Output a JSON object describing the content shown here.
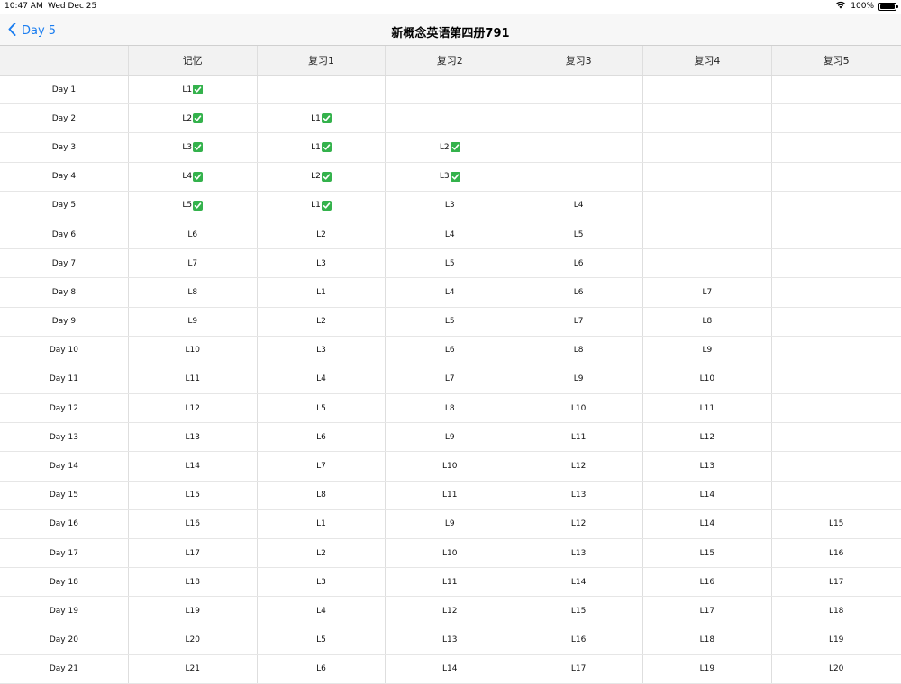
{
  "status_bar": {
    "time": "10:47 AM",
    "date": "Wed Dec 25",
    "battery": "100%",
    "battery_level": 1.0
  },
  "nav": {
    "back_label": "Day 5",
    "title": "新概念英语第四册791"
  },
  "table": {
    "columns": [
      "",
      "记忆",
      "复习1",
      "复习2",
      "复习3",
      "复习4",
      "复习5"
    ],
    "rows": [
      {
        "day": "Day 1",
        "cells": [
          {
            "t": "L1",
            "c": true
          },
          {
            "t": "",
            "c": false
          },
          {
            "t": "",
            "c": false
          },
          {
            "t": "",
            "c": false
          },
          {
            "t": "",
            "c": false
          },
          {
            "t": "",
            "c": false
          }
        ]
      },
      {
        "day": "Day 2",
        "cells": [
          {
            "t": "L2",
            "c": true
          },
          {
            "t": "L1",
            "c": true
          },
          {
            "t": "",
            "c": false
          },
          {
            "t": "",
            "c": false
          },
          {
            "t": "",
            "c": false
          },
          {
            "t": "",
            "c": false
          }
        ]
      },
      {
        "day": "Day 3",
        "cells": [
          {
            "t": "L3",
            "c": true
          },
          {
            "t": "L1",
            "c": true
          },
          {
            "t": "L2",
            "c": true
          },
          {
            "t": "",
            "c": false
          },
          {
            "t": "",
            "c": false
          },
          {
            "t": "",
            "c": false
          }
        ]
      },
      {
        "day": "Day 4",
        "cells": [
          {
            "t": "L4",
            "c": true
          },
          {
            "t": "L2",
            "c": true
          },
          {
            "t": "L3",
            "c": true
          },
          {
            "t": "",
            "c": false
          },
          {
            "t": "",
            "c": false
          },
          {
            "t": "",
            "c": false
          }
        ]
      },
      {
        "day": "Day 5",
        "cells": [
          {
            "t": "L5",
            "c": true
          },
          {
            "t": "L1",
            "c": true
          },
          {
            "t": "L3",
            "c": false
          },
          {
            "t": "L4",
            "c": false
          },
          {
            "t": "",
            "c": false
          },
          {
            "t": "",
            "c": false
          }
        ]
      },
      {
        "day": "Day 6",
        "cells": [
          {
            "t": "L6",
            "c": false
          },
          {
            "t": "L2",
            "c": false
          },
          {
            "t": "L4",
            "c": false
          },
          {
            "t": "L5",
            "c": false
          },
          {
            "t": "",
            "c": false
          },
          {
            "t": "",
            "c": false
          }
        ]
      },
      {
        "day": "Day 7",
        "cells": [
          {
            "t": "L7",
            "c": false
          },
          {
            "t": "L3",
            "c": false
          },
          {
            "t": "L5",
            "c": false
          },
          {
            "t": "L6",
            "c": false
          },
          {
            "t": "",
            "c": false
          },
          {
            "t": "",
            "c": false
          }
        ]
      },
      {
        "day": "Day 8",
        "cells": [
          {
            "t": "L8",
            "c": false
          },
          {
            "t": "L1",
            "c": false
          },
          {
            "t": "L4",
            "c": false
          },
          {
            "t": "L6",
            "c": false
          },
          {
            "t": "L7",
            "c": false
          },
          {
            "t": "",
            "c": false
          }
        ]
      },
      {
        "day": "Day 9",
        "cells": [
          {
            "t": "L9",
            "c": false
          },
          {
            "t": "L2",
            "c": false
          },
          {
            "t": "L5",
            "c": false
          },
          {
            "t": "L7",
            "c": false
          },
          {
            "t": "L8",
            "c": false
          },
          {
            "t": "",
            "c": false
          }
        ]
      },
      {
        "day": "Day 10",
        "cells": [
          {
            "t": "L10",
            "c": false
          },
          {
            "t": "L3",
            "c": false
          },
          {
            "t": "L6",
            "c": false
          },
          {
            "t": "L8",
            "c": false
          },
          {
            "t": "L9",
            "c": false
          },
          {
            "t": "",
            "c": false
          }
        ]
      },
      {
        "day": "Day 11",
        "cells": [
          {
            "t": "L11",
            "c": false
          },
          {
            "t": "L4",
            "c": false
          },
          {
            "t": "L7",
            "c": false
          },
          {
            "t": "L9",
            "c": false
          },
          {
            "t": "L10",
            "c": false
          },
          {
            "t": "",
            "c": false
          }
        ]
      },
      {
        "day": "Day 12",
        "cells": [
          {
            "t": "L12",
            "c": false
          },
          {
            "t": "L5",
            "c": false
          },
          {
            "t": "L8",
            "c": false
          },
          {
            "t": "L10",
            "c": false
          },
          {
            "t": "L11",
            "c": false
          },
          {
            "t": "",
            "c": false
          }
        ]
      },
      {
        "day": "Day 13",
        "cells": [
          {
            "t": "L13",
            "c": false
          },
          {
            "t": "L6",
            "c": false
          },
          {
            "t": "L9",
            "c": false
          },
          {
            "t": "L11",
            "c": false
          },
          {
            "t": "L12",
            "c": false
          },
          {
            "t": "",
            "c": false
          }
        ]
      },
      {
        "day": "Day 14",
        "cells": [
          {
            "t": "L14",
            "c": false
          },
          {
            "t": "L7",
            "c": false
          },
          {
            "t": "L10",
            "c": false
          },
          {
            "t": "L12",
            "c": false
          },
          {
            "t": "L13",
            "c": false
          },
          {
            "t": "",
            "c": false
          }
        ]
      },
      {
        "day": "Day 15",
        "cells": [
          {
            "t": "L15",
            "c": false
          },
          {
            "t": "L8",
            "c": false
          },
          {
            "t": "L11",
            "c": false
          },
          {
            "t": "L13",
            "c": false
          },
          {
            "t": "L14",
            "c": false
          },
          {
            "t": "",
            "c": false
          }
        ]
      },
      {
        "day": "Day 16",
        "cells": [
          {
            "t": "L16",
            "c": false
          },
          {
            "t": "L1",
            "c": false
          },
          {
            "t": "L9",
            "c": false
          },
          {
            "t": "L12",
            "c": false
          },
          {
            "t": "L14",
            "c": false
          },
          {
            "t": "L15",
            "c": false
          }
        ]
      },
      {
        "day": "Day 17",
        "cells": [
          {
            "t": "L17",
            "c": false
          },
          {
            "t": "L2",
            "c": false
          },
          {
            "t": "L10",
            "c": false
          },
          {
            "t": "L13",
            "c": false
          },
          {
            "t": "L15",
            "c": false
          },
          {
            "t": "L16",
            "c": false
          }
        ]
      },
      {
        "day": "Day 18",
        "cells": [
          {
            "t": "L18",
            "c": false
          },
          {
            "t": "L3",
            "c": false
          },
          {
            "t": "L11",
            "c": false
          },
          {
            "t": "L14",
            "c": false
          },
          {
            "t": "L16",
            "c": false
          },
          {
            "t": "L17",
            "c": false
          }
        ]
      },
      {
        "day": "Day 19",
        "cells": [
          {
            "t": "L19",
            "c": false
          },
          {
            "t": "L4",
            "c": false
          },
          {
            "t": "L12",
            "c": false
          },
          {
            "t": "L15",
            "c": false
          },
          {
            "t": "L17",
            "c": false
          },
          {
            "t": "L18",
            "c": false
          }
        ]
      },
      {
        "day": "Day 20",
        "cells": [
          {
            "t": "L20",
            "c": false
          },
          {
            "t": "L5",
            "c": false
          },
          {
            "t": "L13",
            "c": false
          },
          {
            "t": "L16",
            "c": false
          },
          {
            "t": "L18",
            "c": false
          },
          {
            "t": "L19",
            "c": false
          }
        ]
      },
      {
        "day": "Day 21",
        "cells": [
          {
            "t": "L21",
            "c": false
          },
          {
            "t": "L6",
            "c": false
          },
          {
            "t": "L14",
            "c": false
          },
          {
            "t": "L17",
            "c": false
          },
          {
            "t": "L19",
            "c": false
          },
          {
            "t": "L20",
            "c": false
          }
        ]
      }
    ]
  },
  "colors": {
    "accent": "#1a7df0",
    "check": "#34b24c"
  }
}
